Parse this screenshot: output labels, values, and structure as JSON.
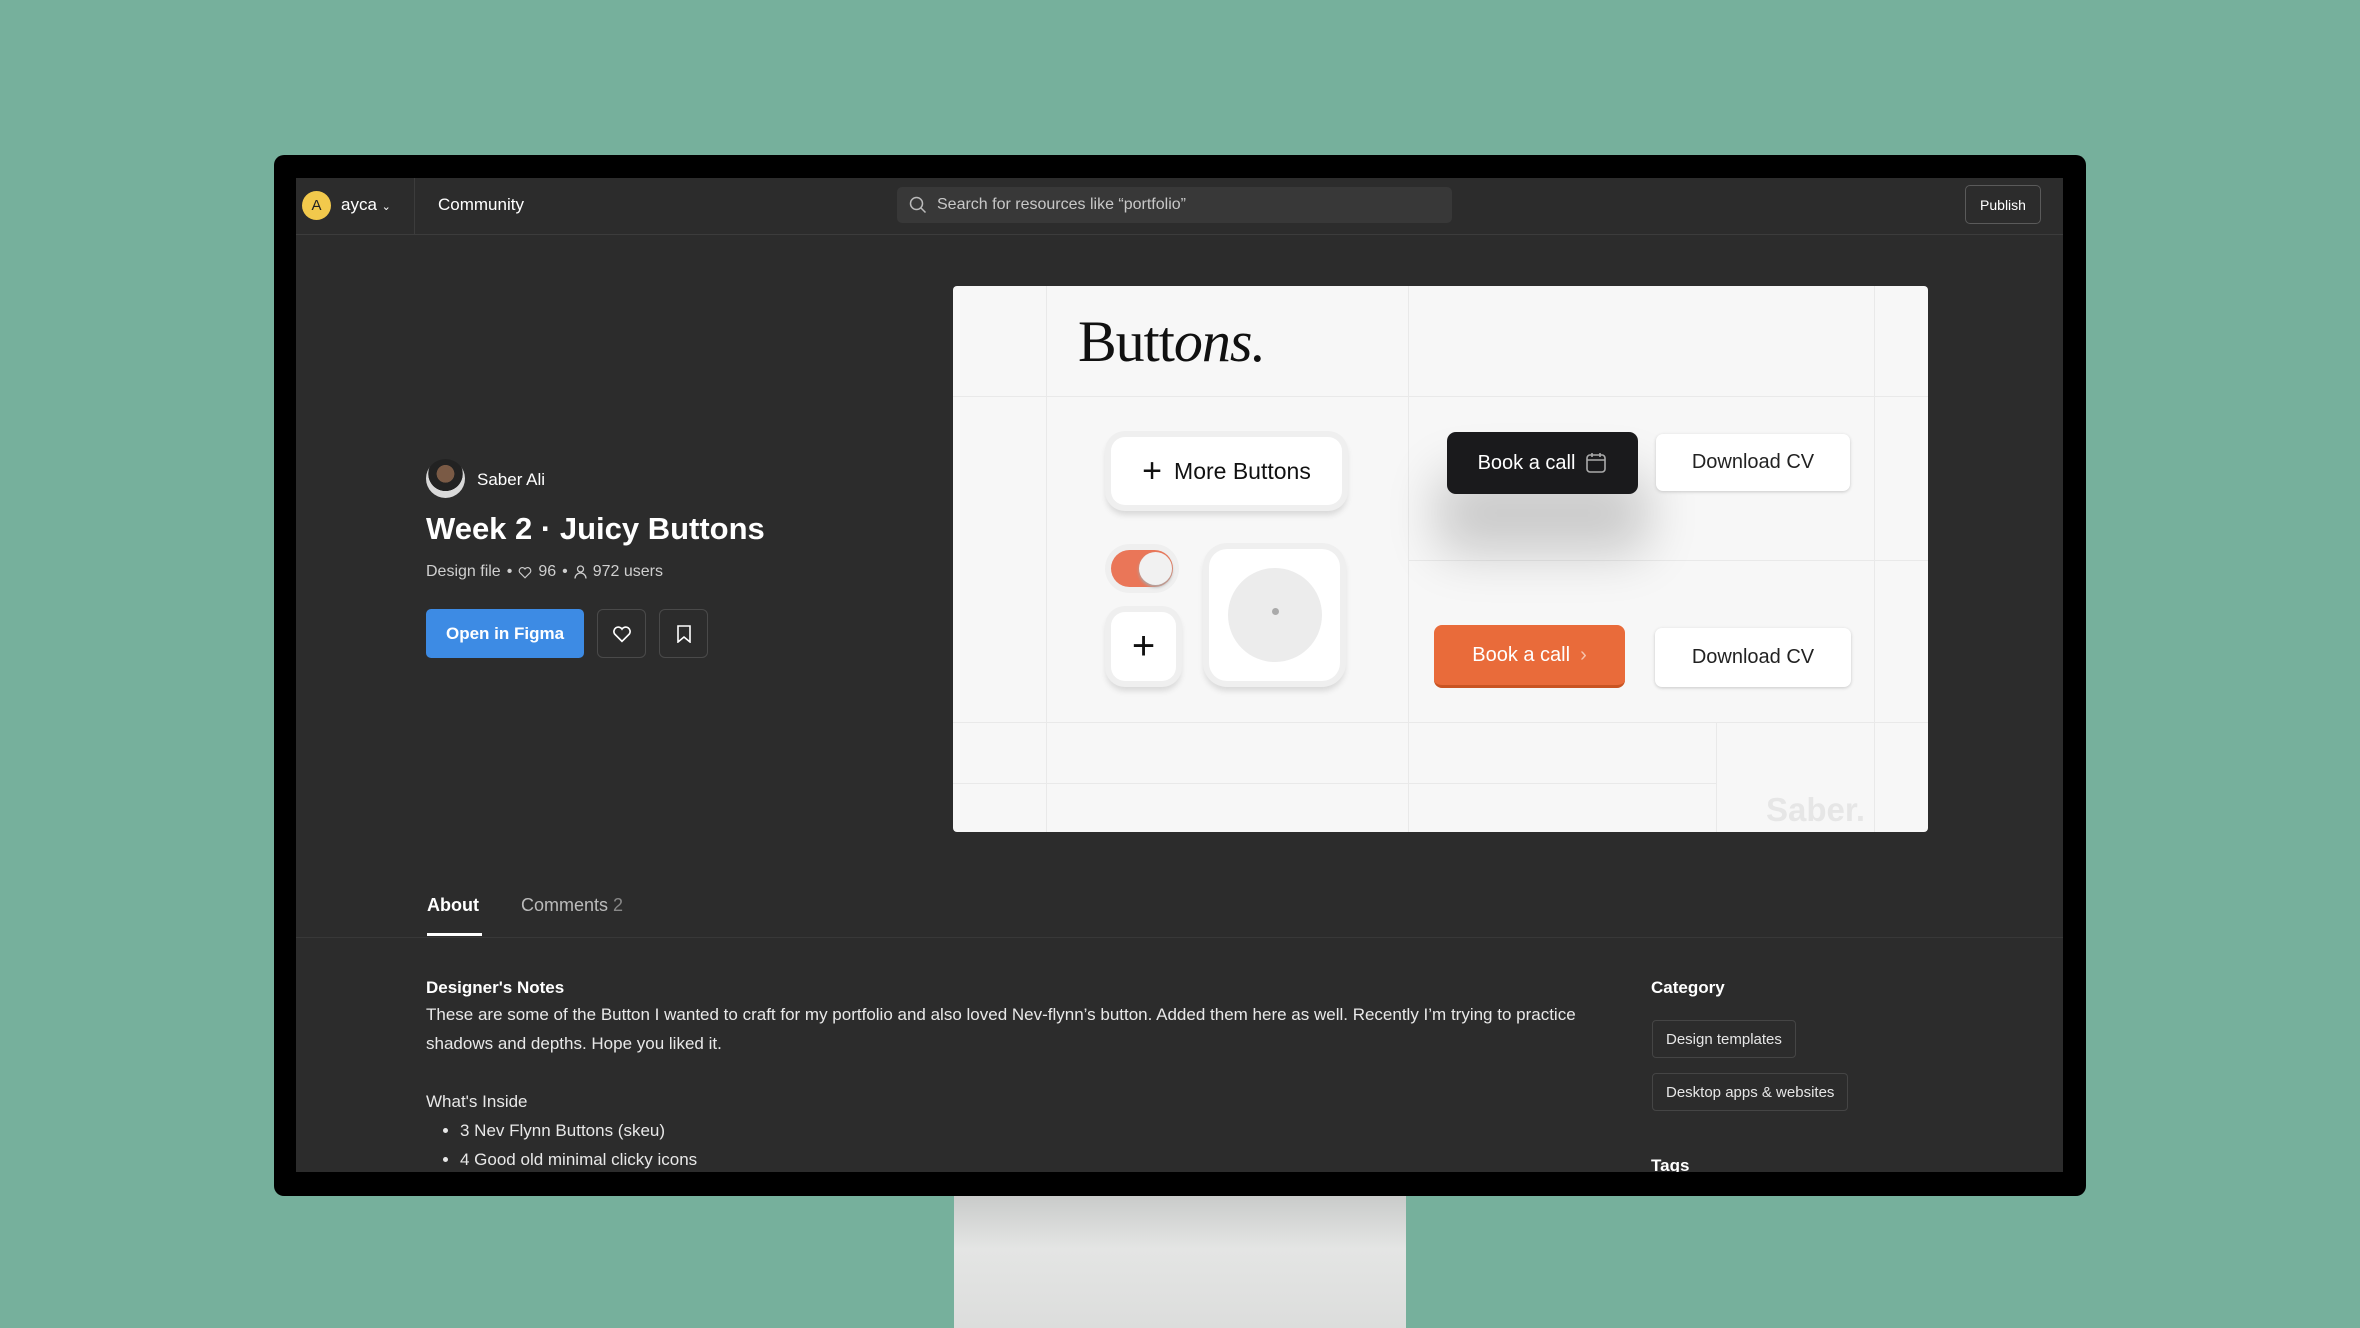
{
  "topbar": {
    "avatar_letter": "A",
    "username": "ayca",
    "community": "Community",
    "search_placeholder": "Search for resources like “portfolio”",
    "publish": "Publish"
  },
  "file": {
    "author": "Saber Ali",
    "title": "Week 2 · Juicy Buttons",
    "type": "Design file",
    "likes": "96",
    "users": "972 users",
    "open_button": "Open in Figma"
  },
  "preview": {
    "logo_plain": "Butt",
    "logo_script": "ons.",
    "more_buttons": "More Buttons",
    "book_call_dark": "Book a call",
    "download_cv_1": "Download CV",
    "book_call_orange": "Book a call",
    "download_cv_2": "Download CV",
    "watermark": "Saber.",
    "toggle_on": true,
    "accent": "#e96b3a"
  },
  "tabs": [
    {
      "label": "About"
    },
    {
      "label": "Comments",
      "count": "2"
    }
  ],
  "about": {
    "notes_heading": "Designer's Notes",
    "notes_text": "These are some of the Button I wanted to craft for my portfolio and also loved Nev-flynn’s button. Added them here as well. Recently I’m trying to practice shadows and depths. Hope you liked it.",
    "inside_heading": "What's Inside",
    "inside_items": [
      "3 Nev Flynn Buttons (skeu)",
      "4 Good old minimal clicky icons"
    ]
  },
  "sidebar": {
    "category_heading": "Category",
    "categories": [
      "Design templates",
      "Desktop apps & websites"
    ],
    "tags_heading": "Tags"
  }
}
